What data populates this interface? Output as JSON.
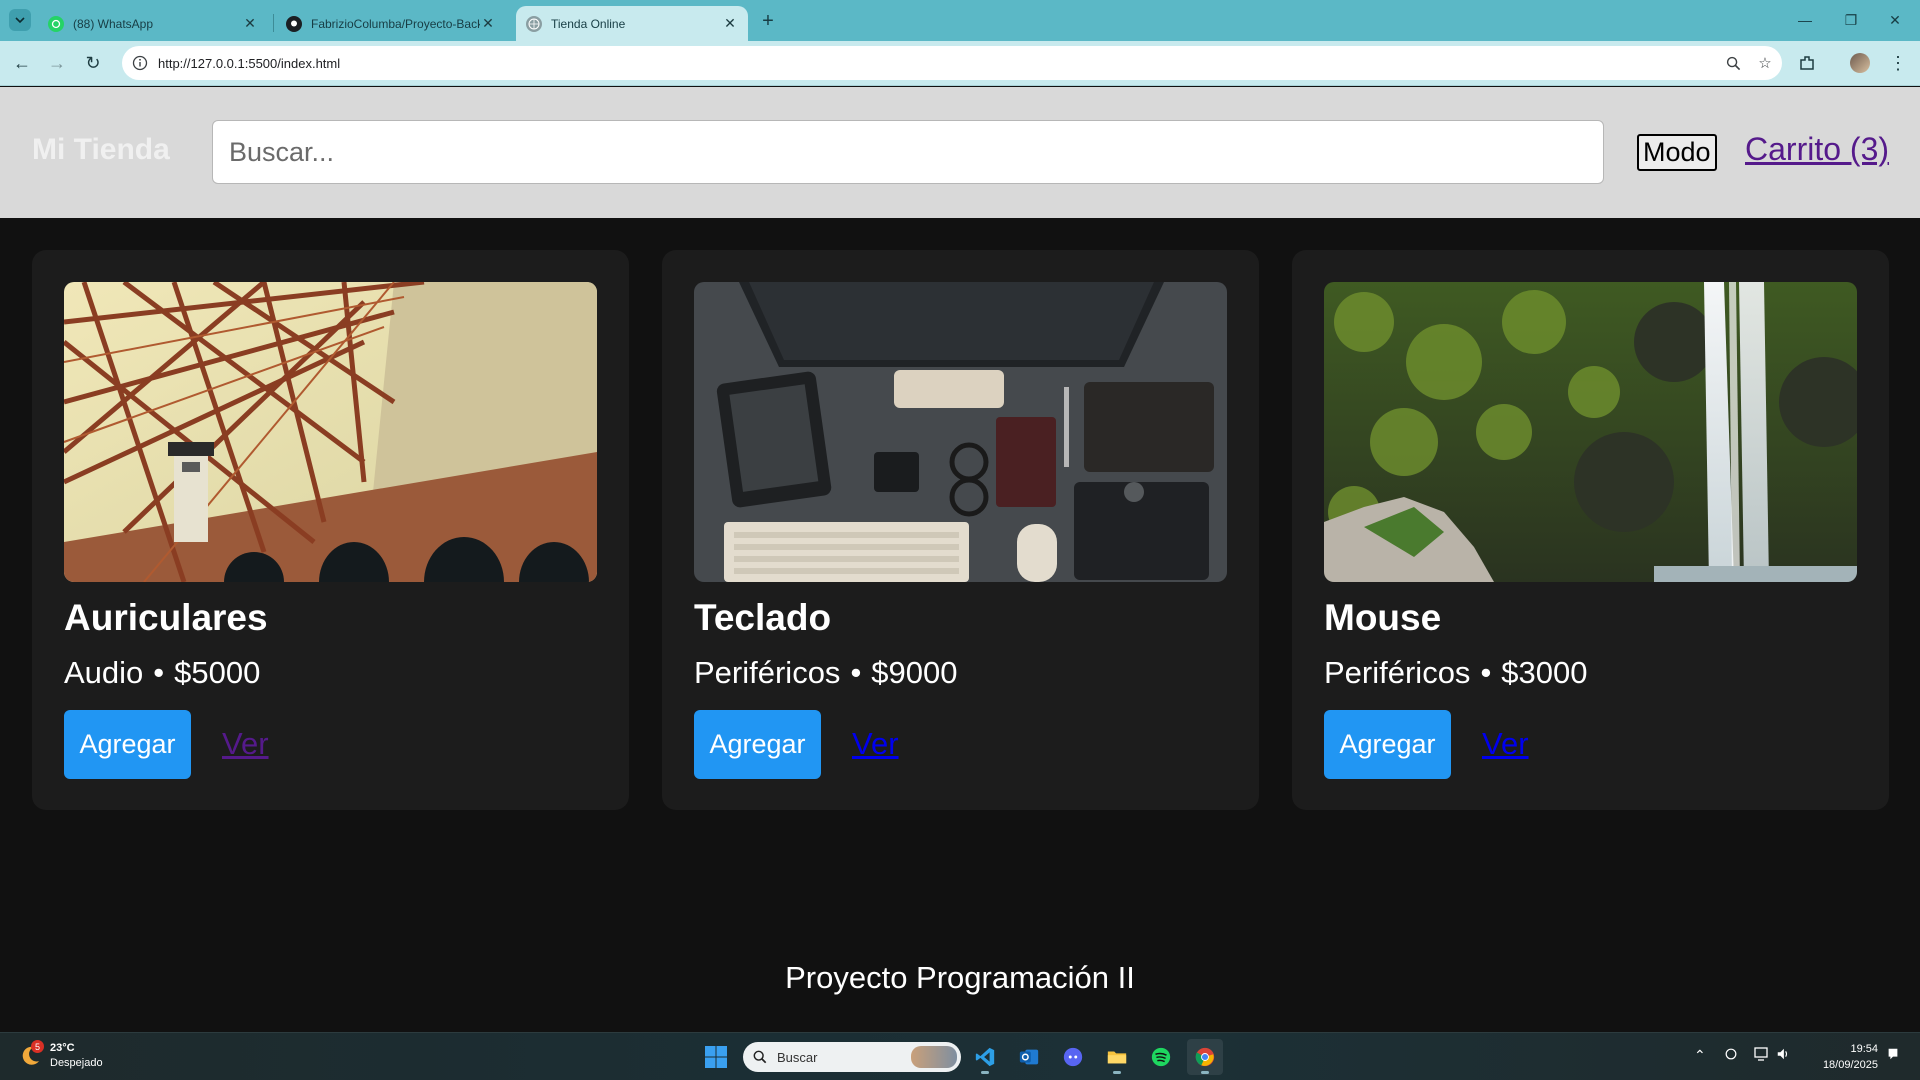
{
  "browser": {
    "tabs": [
      {
        "label": "(88) WhatsApp",
        "icon": "whatsapp-icon",
        "active": false
      },
      {
        "label": "FabrizioColumba/Proyecto-Backend",
        "icon": "github-icon",
        "active": false
      },
      {
        "label": "Tienda Online",
        "icon": "globe-icon",
        "active": true
      }
    ],
    "url": "http://127.0.0.1:5500/index.html"
  },
  "site": {
    "brand": "Mi Tienda",
    "search_placeholder": "Buscar...",
    "mode_label": "Modo",
    "cart_label": "Carrito (3)"
  },
  "products": [
    {
      "name": "Auriculares",
      "category": "Audio",
      "price": "$5000",
      "add_label": "Agregar",
      "view_label": "Ver",
      "image": "bridge-photo",
      "view_visited": true
    },
    {
      "name": "Teclado",
      "category": "Periféricos",
      "price": "$9000",
      "add_label": "Agregar",
      "view_label": "Ver",
      "image": "desk-photo",
      "view_visited": false
    },
    {
      "name": "Mouse",
      "category": "Periféricos",
      "price": "$3000",
      "add_label": "Agregar",
      "view_label": "Ver",
      "image": "waterfall-photo",
      "view_visited": false
    }
  ],
  "meta_separator": "•",
  "footer": "Proyecto Programación II",
  "taskbar": {
    "weather_temp": "23°C",
    "weather_desc": "Despejado",
    "weather_badge": "5",
    "search_label": "Buscar",
    "time": "19:54",
    "date": "18/09/2025"
  },
  "colors": {
    "page_bg": "#111111",
    "card_bg": "#1c1c1c",
    "header_bg": "#d9d9d9",
    "accent": "#2196f3",
    "link_visited": "#551a8b",
    "link": "#0000ee",
    "browser_frame": "#5bb8c6"
  }
}
